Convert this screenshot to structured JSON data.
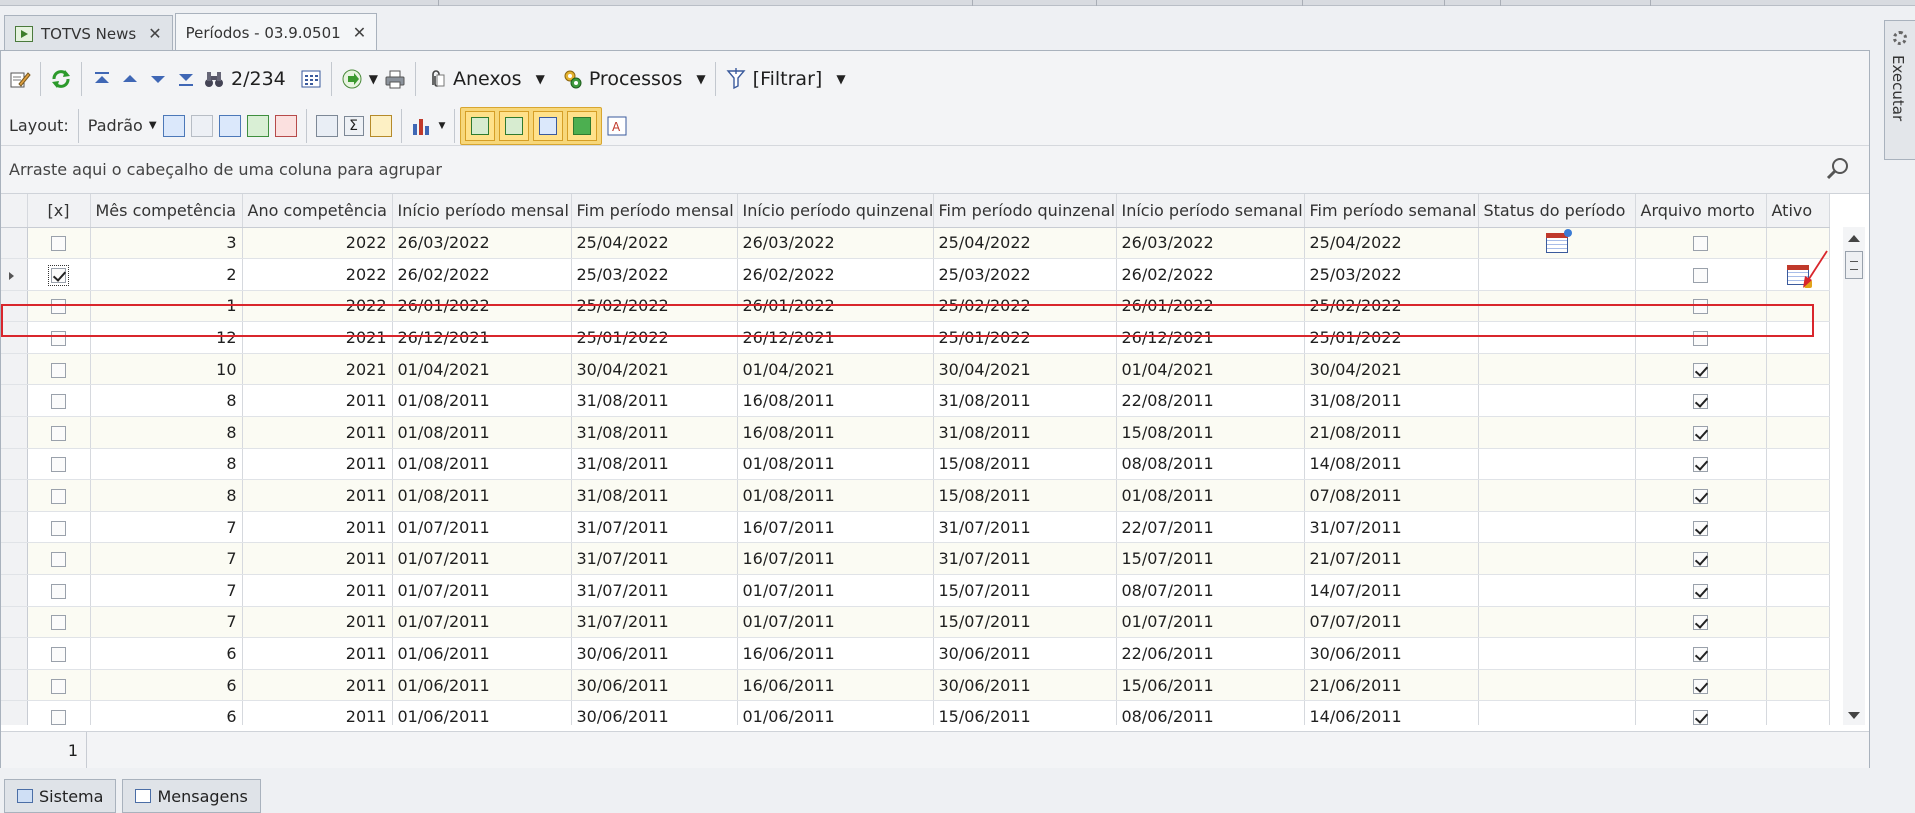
{
  "tabs": [
    {
      "label": "TOTVS News",
      "close": "✕",
      "active": false
    },
    {
      "label": "Períodos - 03.9.0501",
      "close": "✕",
      "active": true
    }
  ],
  "toolbar": {
    "record_counter": "2/234",
    "anexos_label": "Anexos",
    "processos_label": "Processos",
    "filtrar_label": "[Filtrar]"
  },
  "toolbar2": {
    "layout_label": "Layout:",
    "layout_value": "Padrão"
  },
  "group_panel_text": "Arraste aqui o cabeçalho de uma coluna para agrupar",
  "columns": [
    "[x]",
    "Mês competência",
    "Ano competência",
    "Início período mensal",
    "Fim período mensal",
    "Início período quinzenal",
    "Fim período quinzenal",
    "Início período semanal",
    "Fim período semanal",
    "Status do período",
    "Arquivo morto",
    "Ativo"
  ],
  "rows": [
    {
      "x": false,
      "mes": "3",
      "ano": "2022",
      "ini_mensal": "26/03/2022",
      "fim_mensal": "25/04/2022",
      "ini_quinz": "26/03/2022",
      "fim_quinz": "25/04/2022",
      "ini_sem": "26/03/2022",
      "fim_sem": "25/04/2022",
      "status_icon": "calendar-star-icon",
      "arquivo": false,
      "ativo_icon": ""
    },
    {
      "x": true,
      "mes": "2",
      "ano": "2022",
      "ini_mensal": "26/02/2022",
      "fim_mensal": "25/03/2022",
      "ini_quinz": "26/02/2022",
      "fim_quinz": "25/03/2022",
      "ini_sem": "26/02/2022",
      "fim_sem": "25/03/2022",
      "status_icon": "",
      "arquivo": false,
      "ativo_icon": "calendar-lock-icon",
      "current": true
    },
    {
      "x": false,
      "mes": "1",
      "ano": "2022",
      "ini_mensal": "26/01/2022",
      "fim_mensal": "25/02/2022",
      "ini_quinz": "26/01/2022",
      "fim_quinz": "25/02/2022",
      "ini_sem": "26/01/2022",
      "fim_sem": "25/02/2022",
      "status_icon": "",
      "arquivo": false,
      "ativo_icon": ""
    },
    {
      "x": false,
      "mes": "12",
      "ano": "2021",
      "ini_mensal": "26/12/2021",
      "fim_mensal": "25/01/2022",
      "ini_quinz": "26/12/2021",
      "fim_quinz": "25/01/2022",
      "ini_sem": "26/12/2021",
      "fim_sem": "25/01/2022",
      "status_icon": "",
      "arquivo": false,
      "ativo_icon": ""
    },
    {
      "x": false,
      "mes": "10",
      "ano": "2021",
      "ini_mensal": "01/04/2021",
      "fim_mensal": "30/04/2021",
      "ini_quinz": "01/04/2021",
      "fim_quinz": "30/04/2021",
      "ini_sem": "01/04/2021",
      "fim_sem": "30/04/2021",
      "status_icon": "",
      "arquivo": true,
      "ativo_icon": ""
    },
    {
      "x": false,
      "mes": "8",
      "ano": "2011",
      "ini_mensal": "01/08/2011",
      "fim_mensal": "31/08/2011",
      "ini_quinz": "16/08/2011",
      "fim_quinz": "31/08/2011",
      "ini_sem": "22/08/2011",
      "fim_sem": "31/08/2011",
      "status_icon": "",
      "arquivo": true,
      "ativo_icon": ""
    },
    {
      "x": false,
      "mes": "8",
      "ano": "2011",
      "ini_mensal": "01/08/2011",
      "fim_mensal": "31/08/2011",
      "ini_quinz": "16/08/2011",
      "fim_quinz": "31/08/2011",
      "ini_sem": "15/08/2011",
      "fim_sem": "21/08/2011",
      "status_icon": "",
      "arquivo": true,
      "ativo_icon": ""
    },
    {
      "x": false,
      "mes": "8",
      "ano": "2011",
      "ini_mensal": "01/08/2011",
      "fim_mensal": "31/08/2011",
      "ini_quinz": "01/08/2011",
      "fim_quinz": "15/08/2011",
      "ini_sem": "08/08/2011",
      "fim_sem": "14/08/2011",
      "status_icon": "",
      "arquivo": true,
      "ativo_icon": ""
    },
    {
      "x": false,
      "mes": "8",
      "ano": "2011",
      "ini_mensal": "01/08/2011",
      "fim_mensal": "31/08/2011",
      "ini_quinz": "01/08/2011",
      "fim_quinz": "15/08/2011",
      "ini_sem": "01/08/2011",
      "fim_sem": "07/08/2011",
      "status_icon": "",
      "arquivo": true,
      "ativo_icon": ""
    },
    {
      "x": false,
      "mes": "7",
      "ano": "2011",
      "ini_mensal": "01/07/2011",
      "fim_mensal": "31/07/2011",
      "ini_quinz": "16/07/2011",
      "fim_quinz": "31/07/2011",
      "ini_sem": "22/07/2011",
      "fim_sem": "31/07/2011",
      "status_icon": "",
      "arquivo": true,
      "ativo_icon": ""
    },
    {
      "x": false,
      "mes": "7",
      "ano": "2011",
      "ini_mensal": "01/07/2011",
      "fim_mensal": "31/07/2011",
      "ini_quinz": "16/07/2011",
      "fim_quinz": "31/07/2011",
      "ini_sem": "15/07/2011",
      "fim_sem": "21/07/2011",
      "status_icon": "",
      "arquivo": true,
      "ativo_icon": ""
    },
    {
      "x": false,
      "mes": "7",
      "ano": "2011",
      "ini_mensal": "01/07/2011",
      "fim_mensal": "31/07/2011",
      "ini_quinz": "01/07/2011",
      "fim_quinz": "15/07/2011",
      "ini_sem": "08/07/2011",
      "fim_sem": "14/07/2011",
      "status_icon": "",
      "arquivo": true,
      "ativo_icon": ""
    },
    {
      "x": false,
      "mes": "7",
      "ano": "2011",
      "ini_mensal": "01/07/2011",
      "fim_mensal": "31/07/2011",
      "ini_quinz": "01/07/2011",
      "fim_quinz": "15/07/2011",
      "ini_sem": "01/07/2011",
      "fim_sem": "07/07/2011",
      "status_icon": "",
      "arquivo": true,
      "ativo_icon": ""
    },
    {
      "x": false,
      "mes": "6",
      "ano": "2011",
      "ini_mensal": "01/06/2011",
      "fim_mensal": "30/06/2011",
      "ini_quinz": "16/06/2011",
      "fim_quinz": "30/06/2011",
      "ini_sem": "22/06/2011",
      "fim_sem": "30/06/2011",
      "status_icon": "",
      "arquivo": true,
      "ativo_icon": ""
    },
    {
      "x": false,
      "mes": "6",
      "ano": "2011",
      "ini_mensal": "01/06/2011",
      "fim_mensal": "30/06/2011",
      "ini_quinz": "16/06/2011",
      "fim_quinz": "30/06/2011",
      "ini_sem": "15/06/2011",
      "fim_sem": "21/06/2011",
      "status_icon": "",
      "arquivo": true,
      "ativo_icon": ""
    },
    {
      "x": false,
      "mes": "6",
      "ano": "2011",
      "ini_mensal": "01/06/2011",
      "fim_mensal": "30/06/2011",
      "ini_quinz": "01/06/2011",
      "fim_quinz": "15/06/2011",
      "ini_sem": "08/06/2011",
      "fim_sem": "14/06/2011",
      "status_icon": "",
      "arquivo": true,
      "ativo_icon": ""
    }
  ],
  "footer_count": "1",
  "side_tab_label": "Executar",
  "bottom_tabs": [
    "Sistema",
    "Mensagens"
  ],
  "colors": {
    "accent_highlight": "#d9262c",
    "toolbar_toggle": "#ffe18a"
  }
}
